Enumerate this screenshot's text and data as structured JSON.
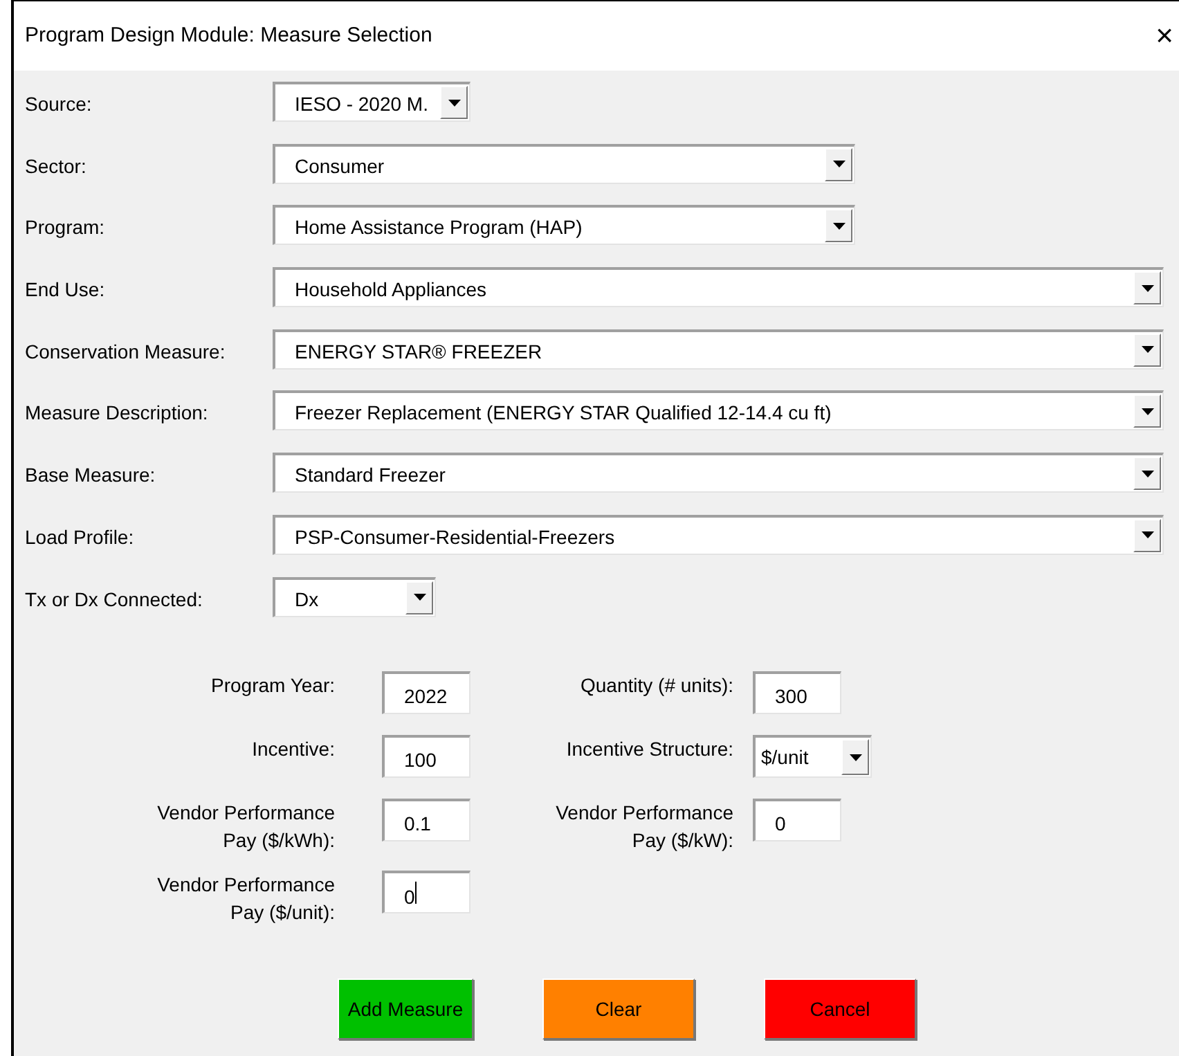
{
  "window": {
    "title": "Program Design Module: Measure Selection",
    "close": "×"
  },
  "selections": [
    {
      "label": "Source:",
      "value": "IESO - 2020 M."
    },
    {
      "label": "Sector:",
      "value": "Consumer"
    },
    {
      "label": "Program:",
      "value": "Home Assistance Program (HAP)"
    },
    {
      "label": "End Use:",
      "value": "Household Appliances"
    },
    {
      "label": "Conservation Measure:",
      "value": "ENERGY STAR® FREEZER"
    },
    {
      "label": "Measure Description:",
      "value": "Freezer Replacement (ENERGY STAR Qualified 12-14.4 cu ft)"
    },
    {
      "label": "Base Measure:",
      "value": "Standard Freezer"
    },
    {
      "label": "Load Profile:",
      "value": "PSP-Consumer-Residential-Freezers"
    },
    {
      "label": "Tx or Dx Connected:",
      "value": "Dx"
    }
  ],
  "fields": [
    {
      "label": "Program Year:",
      "value": "2022",
      "kind": "text",
      "focused": false
    },
    {
      "label": "Quantity (# units):",
      "value": "300",
      "kind": "text",
      "focused": false
    },
    {
      "label": "Incentive:",
      "value": "100",
      "kind": "text",
      "focused": false
    },
    {
      "label": "Incentive Structure:",
      "value": "$/unit",
      "kind": "combo",
      "focused": false
    },
    {
      "label": "Vendor Performance Pay ($/kWh):",
      "value": "0.1",
      "kind": "text",
      "focused": false
    },
    {
      "label": "Vendor Performance Pay ($/kW):",
      "value": "0",
      "kind": "text",
      "focused": false
    },
    {
      "label": "Vendor Performance Pay ($/unit):",
      "value": "0",
      "kind": "text",
      "focused": true
    }
  ],
  "buttons": [
    {
      "label": "Add Measure",
      "color": "#00c000"
    },
    {
      "label": "Clear",
      "color": "#ff8000"
    },
    {
      "label": "Cancel",
      "color": "#ff0000"
    }
  ]
}
